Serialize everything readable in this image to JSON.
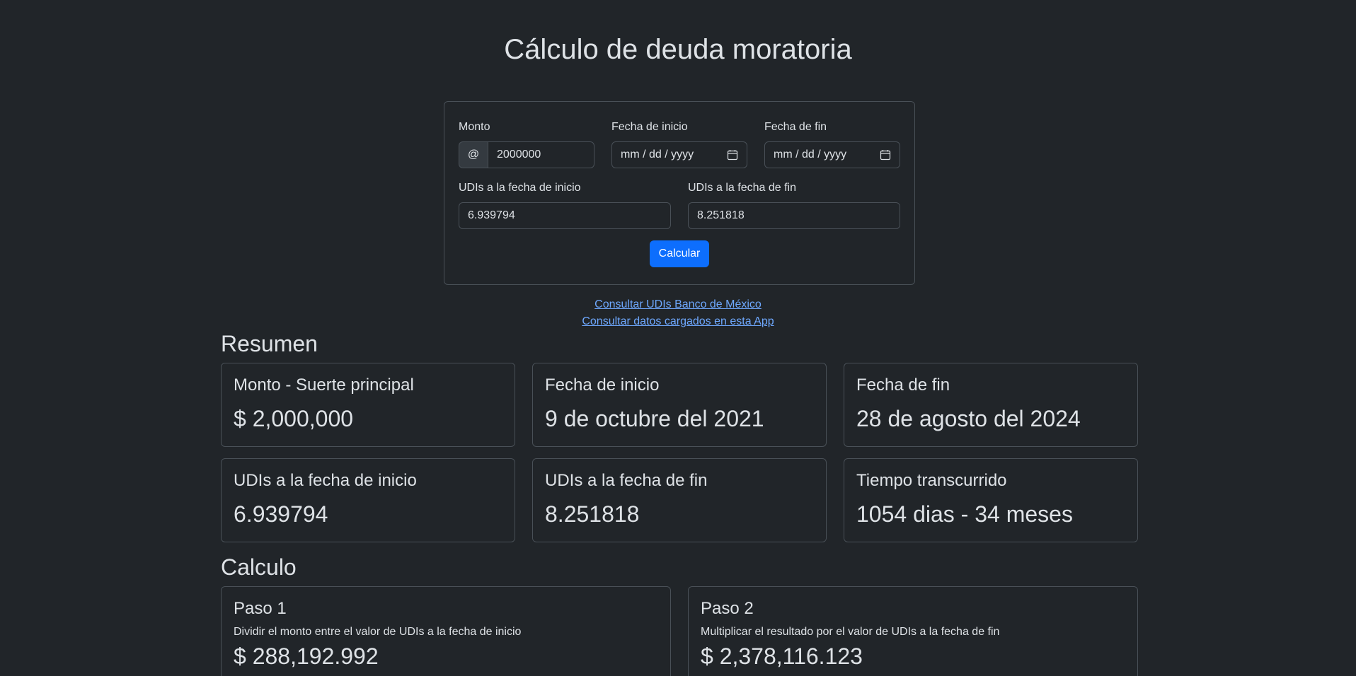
{
  "title": "Cálculo de deuda moratoria",
  "form": {
    "monto_label": "Monto",
    "monto_addon": "@",
    "monto_value": "2000000",
    "fecha_inicio_label": "Fecha de inicio",
    "fecha_inicio_placeholder": "mm / dd / yyyy",
    "fecha_fin_label": "Fecha de fin",
    "fecha_fin_placeholder": "mm / dd / yyyy",
    "udis_inicio_label": "UDIs a la fecha de inicio",
    "udis_inicio_value": "6.939794",
    "udis_fin_label": "UDIs a la fecha de fin",
    "udis_fin_value": "8.251818",
    "calc_button": "Calcular"
  },
  "links": {
    "banxico": "Consultar UDIs Banco de México",
    "app_data": "Consultar datos cargados en esta App"
  },
  "resumen": {
    "heading": "Resumen",
    "cards": [
      {
        "title": "Monto - Suerte principal",
        "value": "$ 2,000,000"
      },
      {
        "title": "Fecha de inicio",
        "value": "9 de octubre del 2021"
      },
      {
        "title": "Fecha de fin",
        "value": "28 de agosto del 2024"
      },
      {
        "title": "UDIs a la fecha de inicio",
        "value": "6.939794"
      },
      {
        "title": "UDIs a la fecha de fin",
        "value": "8.251818"
      },
      {
        "title": "Tiempo transcurrido",
        "value": "1054 dias - 34 meses"
      }
    ]
  },
  "calculo": {
    "heading": "Calculo",
    "steps": [
      {
        "title": "Paso 1",
        "desc": "Dividir el monto entre el valor de UDIs a la fecha de inicio",
        "value": "$ 288,192.992"
      },
      {
        "title": "Paso 2",
        "desc": "Multiplicar el resultado por el valor de UDIs a la fecha de fin",
        "value": "$ 2,378,116.123"
      }
    ]
  },
  "icons": {
    "calendar": "calendar-icon"
  },
  "colors": {
    "background": "#212529",
    "primary": "#0d6efd",
    "link": "#6ea8fe",
    "border": "#495057"
  }
}
